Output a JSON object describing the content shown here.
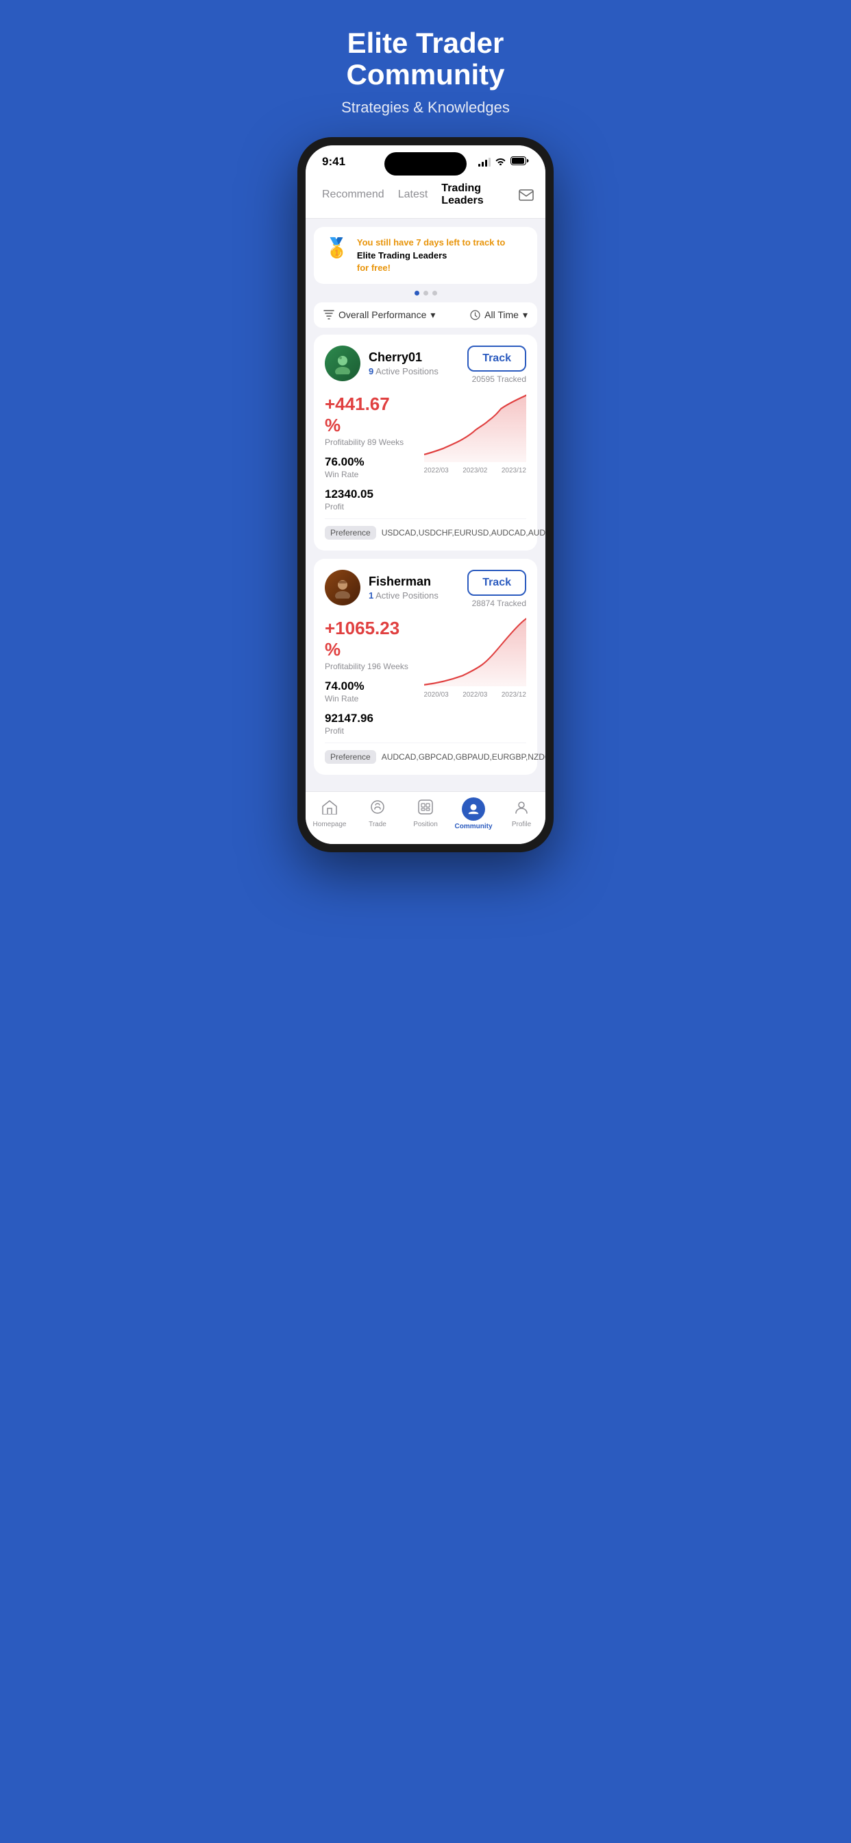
{
  "hero": {
    "title": "Elite Trader Community",
    "subtitle": "Strategies & Knowledges"
  },
  "status_bar": {
    "time": "9:41"
  },
  "nav_tabs": [
    {
      "id": "recommend",
      "label": "Recommend",
      "active": false
    },
    {
      "id": "latest",
      "label": "Latest",
      "active": false
    },
    {
      "id": "trading_leaders",
      "label": "Trading Leaders",
      "active": true
    }
  ],
  "promo_banner": {
    "icon": "🥇",
    "highlight_text": "You still have 7 days left to track to",
    "bold_text": "Elite Trading Leaders",
    "suffix_text": "for free!"
  },
  "filter": {
    "performance_label": "Overall Performance",
    "time_label": "All Time"
  },
  "traders": [
    {
      "id": "cherry01",
      "name": "Cherry01",
      "active_positions": "9",
      "track_label": "Track",
      "tracked_count": "20595 Tracked",
      "profit_pct": "+441.67 %",
      "profitability_weeks": "Profitability 89 Weeks",
      "win_rate": "76.00%",
      "win_rate_label": "Win Rate",
      "profit": "12340.05",
      "profit_label": "Profit",
      "chart_dates": [
        "2022/03",
        "2023/02",
        "2023/12"
      ],
      "preference_label": "Preference",
      "preference_values": "USDCAD,USDCHF,EURUSD,AUDCAD,AUDUSD"
    },
    {
      "id": "fisherman",
      "name": "Fisherman",
      "active_positions": "1",
      "track_label": "Track",
      "tracked_count": "28874 Tracked",
      "profit_pct": "+1065.23 %",
      "profitability_weeks": "Profitability 196 Weeks",
      "win_rate": "74.00%",
      "win_rate_label": "Win Rate",
      "profit": "92147.96",
      "profit_label": "Profit",
      "chart_dates": [
        "2020/03",
        "2022/03",
        "2023/12"
      ],
      "preference_label": "Preference",
      "preference_values": "AUDCAD,GBPCAD,GBPAUD,EURGBP,NZDCAD"
    }
  ],
  "bottom_nav": [
    {
      "id": "homepage",
      "label": "Homepage",
      "icon": "home",
      "active": false
    },
    {
      "id": "trade",
      "label": "Trade",
      "icon": "trade",
      "active": false
    },
    {
      "id": "position",
      "label": "Position",
      "icon": "position",
      "active": false
    },
    {
      "id": "community",
      "label": "Community",
      "icon": "community",
      "active": true
    },
    {
      "id": "profile",
      "label": "Profile",
      "icon": "profile",
      "active": false
    }
  ]
}
